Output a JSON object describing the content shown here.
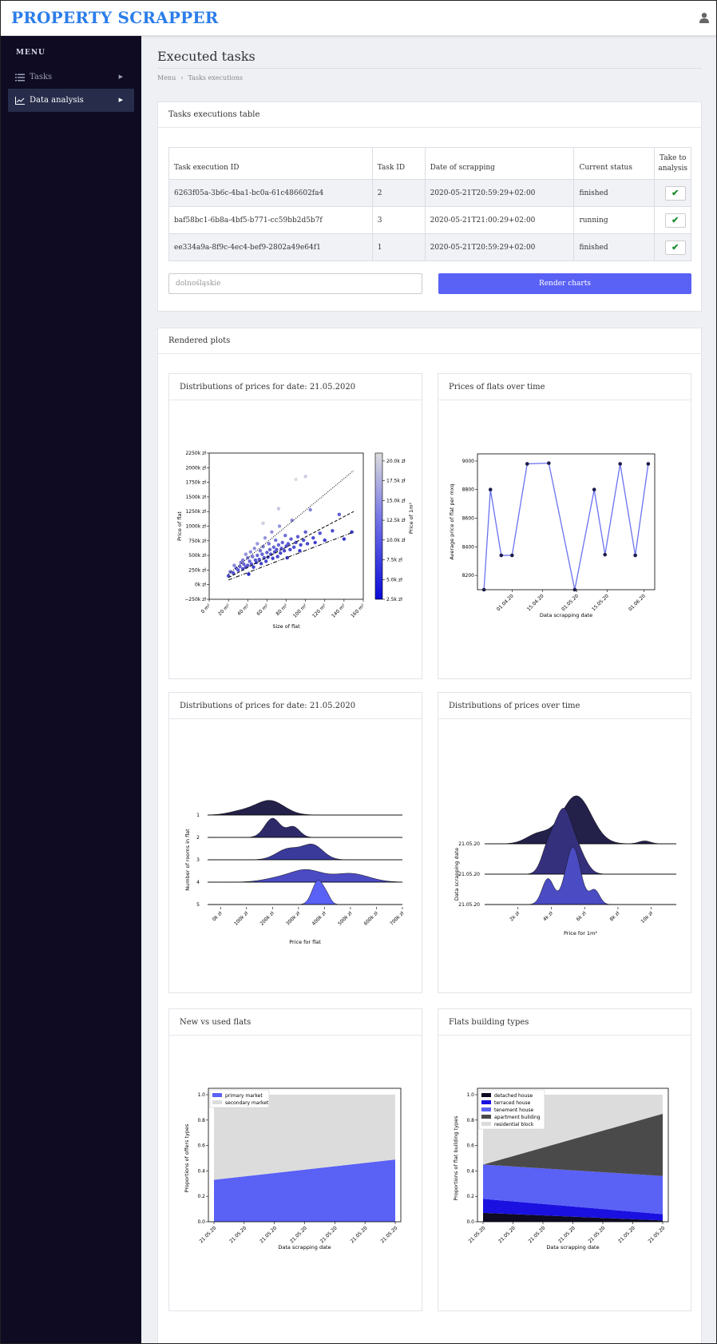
{
  "app": {
    "brand": "PROPERTY SCRAPPER"
  },
  "sidebar": {
    "menu_title": "MENU",
    "items": [
      {
        "label": "Tasks",
        "icon": "list-icon"
      },
      {
        "label": "Data analysis",
        "icon": "chart-icon"
      }
    ]
  },
  "page": {
    "title": "Executed tasks",
    "breadcrumb": [
      "Menu",
      "Tasks executions"
    ]
  },
  "tasks_card": {
    "title": "Tasks executions table",
    "columns": [
      "Task execution ID",
      "Task ID",
      "Date of scrapping",
      "Current status",
      "Take to analysis"
    ],
    "rows": [
      {
        "id": "6263f05a-3b6c-4ba1-bc0a-61c486602fa4",
        "task_id": "2",
        "date": "2020-05-21T20:59:29+02:00",
        "status": "finished"
      },
      {
        "id": "baf58bc1-6b8a-4bf5-b771-cc59bb2d5b7f",
        "task_id": "3",
        "date": "2020-05-21T21:00:29+02:00",
        "status": "running"
      },
      {
        "id": "ee334a9a-8f9c-4ec4-bef9-2802a49e64f1",
        "task_id": "1",
        "date": "2020-05-21T20:59:29+02:00",
        "status": "finished"
      }
    ],
    "region_placeholder": "dolnośląskie",
    "render_button": "Render charts"
  },
  "plots_card": {
    "title": "Rendered plots"
  },
  "colors": {
    "accent": "#5a61f5",
    "brand": "#2b7de9",
    "sidebar": "#0e0b22",
    "dark_series": "#23204a",
    "light_series": "#dcdcdc"
  },
  "chart_data": [
    {
      "panel_title": "Distributions of prices for date: 21.05.2020",
      "type": "scatter",
      "xlabel": "Size of flat",
      "ylabel": "Price of flat",
      "xlim": [
        0,
        160
      ],
      "ylim": [
        -250000,
        2250000
      ],
      "x_ticks": [
        "0 m²",
        "20 m²",
        "40 m²",
        "60 m²",
        "80 m²",
        "100 m²",
        "120 m²",
        "140 m²",
        "160 m²"
      ],
      "y_ticks": [
        "−250k zł",
        "0k zł",
        "250k zł",
        "500k zł",
        "750k zł",
        "1000k zł",
        "1250k zł",
        "1500k zł",
        "1750k zł",
        "2000k zł",
        "2250k zł"
      ],
      "colorbar": {
        "label": "Price of 1m²",
        "ticks": [
          "2.5k zł",
          "5.0k zł",
          "7.5k zł",
          "10.0k zł",
          "12.5k zł",
          "15.0k zł",
          "17.5k zł",
          "20.0k zł"
        ]
      },
      "points": [
        [
          20,
          150000
        ],
        [
          22,
          220000
        ],
        [
          25,
          200000
        ],
        [
          26,
          330000
        ],
        [
          28,
          280000
        ],
        [
          30,
          250000
        ],
        [
          32,
          310000
        ],
        [
          33,
          380000
        ],
        [
          35,
          270000
        ],
        [
          35,
          420000
        ],
        [
          36,
          350000
        ],
        [
          38,
          300000
        ],
        [
          38,
          520000
        ],
        [
          40,
          330000
        ],
        [
          40,
          460000
        ],
        [
          41,
          180000
        ],
        [
          42,
          400000
        ],
        [
          43,
          560000
        ],
        [
          44,
          350000
        ],
        [
          45,
          480000
        ],
        [
          46,
          300000
        ],
        [
          47,
          620000
        ],
        [
          48,
          420000
        ],
        [
          49,
          380000
        ],
        [
          50,
          500000
        ],
        [
          50,
          700000
        ],
        [
          52,
          430000
        ],
        [
          53,
          580000
        ],
        [
          54,
          360000
        ],
        [
          55,
          520000
        ],
        [
          56,
          650000
        ],
        [
          57,
          460000
        ],
        [
          58,
          800000
        ],
        [
          59,
          400000
        ],
        [
          60,
          550000
        ],
        [
          61,
          470000
        ],
        [
          62,
          700000
        ],
        [
          63,
          600000
        ],
        [
          64,
          520000
        ],
        [
          65,
          900000
        ],
        [
          66,
          450000
        ],
        [
          67,
          640000
        ],
        [
          68,
          560000
        ],
        [
          69,
          760000
        ],
        [
          70,
          600000
        ],
        [
          71,
          480000
        ],
        [
          72,
          680000
        ],
        [
          73,
          1000000
        ],
        [
          74,
          540000
        ],
        [
          75,
          620000
        ],
        [
          76,
          720000
        ],
        [
          78,
          580000
        ],
        [
          79,
          840000
        ],
        [
          80,
          660000
        ],
        [
          81,
          460000
        ],
        [
          82,
          700000
        ],
        [
          84,
          600000
        ],
        [
          85,
          780000
        ],
        [
          86,
          1100000
        ],
        [
          88,
          640000
        ],
        [
          90,
          720000
        ],
        [
          92,
          820000
        ],
        [
          94,
          580000
        ],
        [
          95,
          680000
        ],
        [
          98,
          760000
        ],
        [
          100,
          900000
        ],
        [
          102,
          700000
        ],
        [
          105,
          1280000
        ],
        [
          108,
          800000
        ],
        [
          110,
          720000
        ],
        [
          115,
          880000
        ],
        [
          120,
          760000
        ],
        [
          128,
          920000
        ],
        [
          135,
          1200000
        ],
        [
          140,
          780000
        ],
        [
          148,
          900000
        ],
        [
          90,
          1800000
        ],
        [
          100,
          1850000
        ],
        [
          72,
          1300000
        ],
        [
          56,
          1050000
        ]
      ],
      "regression_lines": [
        {
          "style": "dotted",
          "from": [
            20,
            180000
          ],
          "to": [
            150,
            1950000
          ]
        },
        {
          "style": "dashed",
          "from": [
            20,
            120000
          ],
          "to": [
            150,
            1250000
          ]
        },
        {
          "style": "dashdot",
          "from": [
            20,
            80000
          ],
          "to": [
            150,
            900000
          ]
        }
      ]
    },
    {
      "panel_title": "Prices of flats over time",
      "type": "line",
      "xlabel": "Data scrapping date",
      "ylabel": "Average price of flat per mxq",
      "x_ticks": [
        "01.04.20",
        "15.04.20",
        "01.05.20",
        "15.05.20",
        "01.06.20"
      ],
      "ylim": [
        8100,
        9050
      ],
      "y_ticks": [
        "8200",
        "8400",
        "8600",
        "8800",
        "9000"
      ],
      "x": [
        "2020-03-19",
        "2020-03-22",
        "2020-03-27",
        "2020-04-01",
        "2020-04-08",
        "2020-04-18",
        "2020-04-30",
        "2020-05-09",
        "2020-05-14",
        "2020-05-21",
        "2020-05-28",
        "2020-06-03"
      ],
      "values": [
        8100,
        8800,
        8340,
        8340,
        8980,
        8985,
        8100,
        8800,
        8345,
        8980,
        8340,
        8980
      ]
    },
    {
      "panel_title": "Distributions of prices for date: 21.05.2020",
      "type": "area",
      "xlabel": "Price for flat",
      "ylabel": "Number of rooms in flat",
      "x_ticks": [
        "0k zł",
        "100k zł",
        "200k zł",
        "300k zł",
        "400k zł",
        "500k zł",
        "600k zł",
        "700k zł"
      ],
      "series": [
        {
          "name": "1",
          "peak": 180000,
          "width": 70000
        },
        {
          "name": "2",
          "peak": 220000,
          "width": 45000
        },
        {
          "name": "3",
          "peak": 340000,
          "width": 60000
        },
        {
          "name": "4",
          "peak": 390000,
          "width": 120000
        },
        {
          "name": "5",
          "peak": 390000,
          "width": 28000
        }
      ]
    },
    {
      "panel_title": "Distributions of prices over time",
      "type": "area",
      "xlabel": "Price for 1m²",
      "ylabel": "Data scrapping date",
      "x_ticks": [
        "2k zł",
        "4k zł",
        "6k zł",
        "8k zł",
        "10k zł"
      ],
      "series": [
        {
          "name": "21.05.20",
          "peak": 5400,
          "width": 1100
        },
        {
          "name": "21.05.20",
          "peak": 4800,
          "width": 700
        },
        {
          "name": "21.05.20",
          "peak": 5200,
          "width": 650
        }
      ]
    },
    {
      "panel_title": "New vs used flats",
      "type": "area",
      "xlabel": "Data scrapping date",
      "ylabel": "Proportions of offers types",
      "ylim": [
        0,
        1
      ],
      "y_ticks": [
        "0.0",
        "0.2",
        "0.4",
        "0.6",
        "0.8",
        "1.0"
      ],
      "x_ticks": [
        "21.05.20",
        "21.05.20",
        "21.05.20",
        "21.05.20",
        "21.05.20",
        "21.05.20",
        "21.05.20"
      ],
      "series": [
        {
          "name": "primary market",
          "start": 0.33,
          "end": 0.49,
          "color": "#5a61f5"
        },
        {
          "name": "secondary market",
          "start": 0.67,
          "end": 0.51,
          "color": "#dcdcdc"
        }
      ]
    },
    {
      "panel_title": "Flats building types",
      "type": "area",
      "xlabel": "Data scrapping date",
      "ylabel": "Proportions of flat building types",
      "ylim": [
        0,
        1
      ],
      "y_ticks": [
        "0.0",
        "0.2",
        "0.4",
        "0.6",
        "0.8",
        "1.0"
      ],
      "x_ticks": [
        "21.05.20",
        "21.05.20",
        "21.05.20",
        "21.05.20",
        "21.05.20",
        "21.05.20",
        "21.05.20"
      ],
      "series": [
        {
          "name": "detached house",
          "start": 0.07,
          "end": 0.01,
          "color": "#0e0b22"
        },
        {
          "name": "terraced house",
          "start": 0.11,
          "end": 0.05,
          "color": "#1a10e0"
        },
        {
          "name": "tenement house",
          "start": 0.27,
          "end": 0.3,
          "color": "#5a61f5"
        },
        {
          "name": "apartment building",
          "start": 0.0,
          "end": 0.49,
          "color": "#4a4a4a"
        },
        {
          "name": "residential block",
          "start": 0.55,
          "end": 0.15,
          "color": "#dcdcdc"
        }
      ]
    }
  ]
}
